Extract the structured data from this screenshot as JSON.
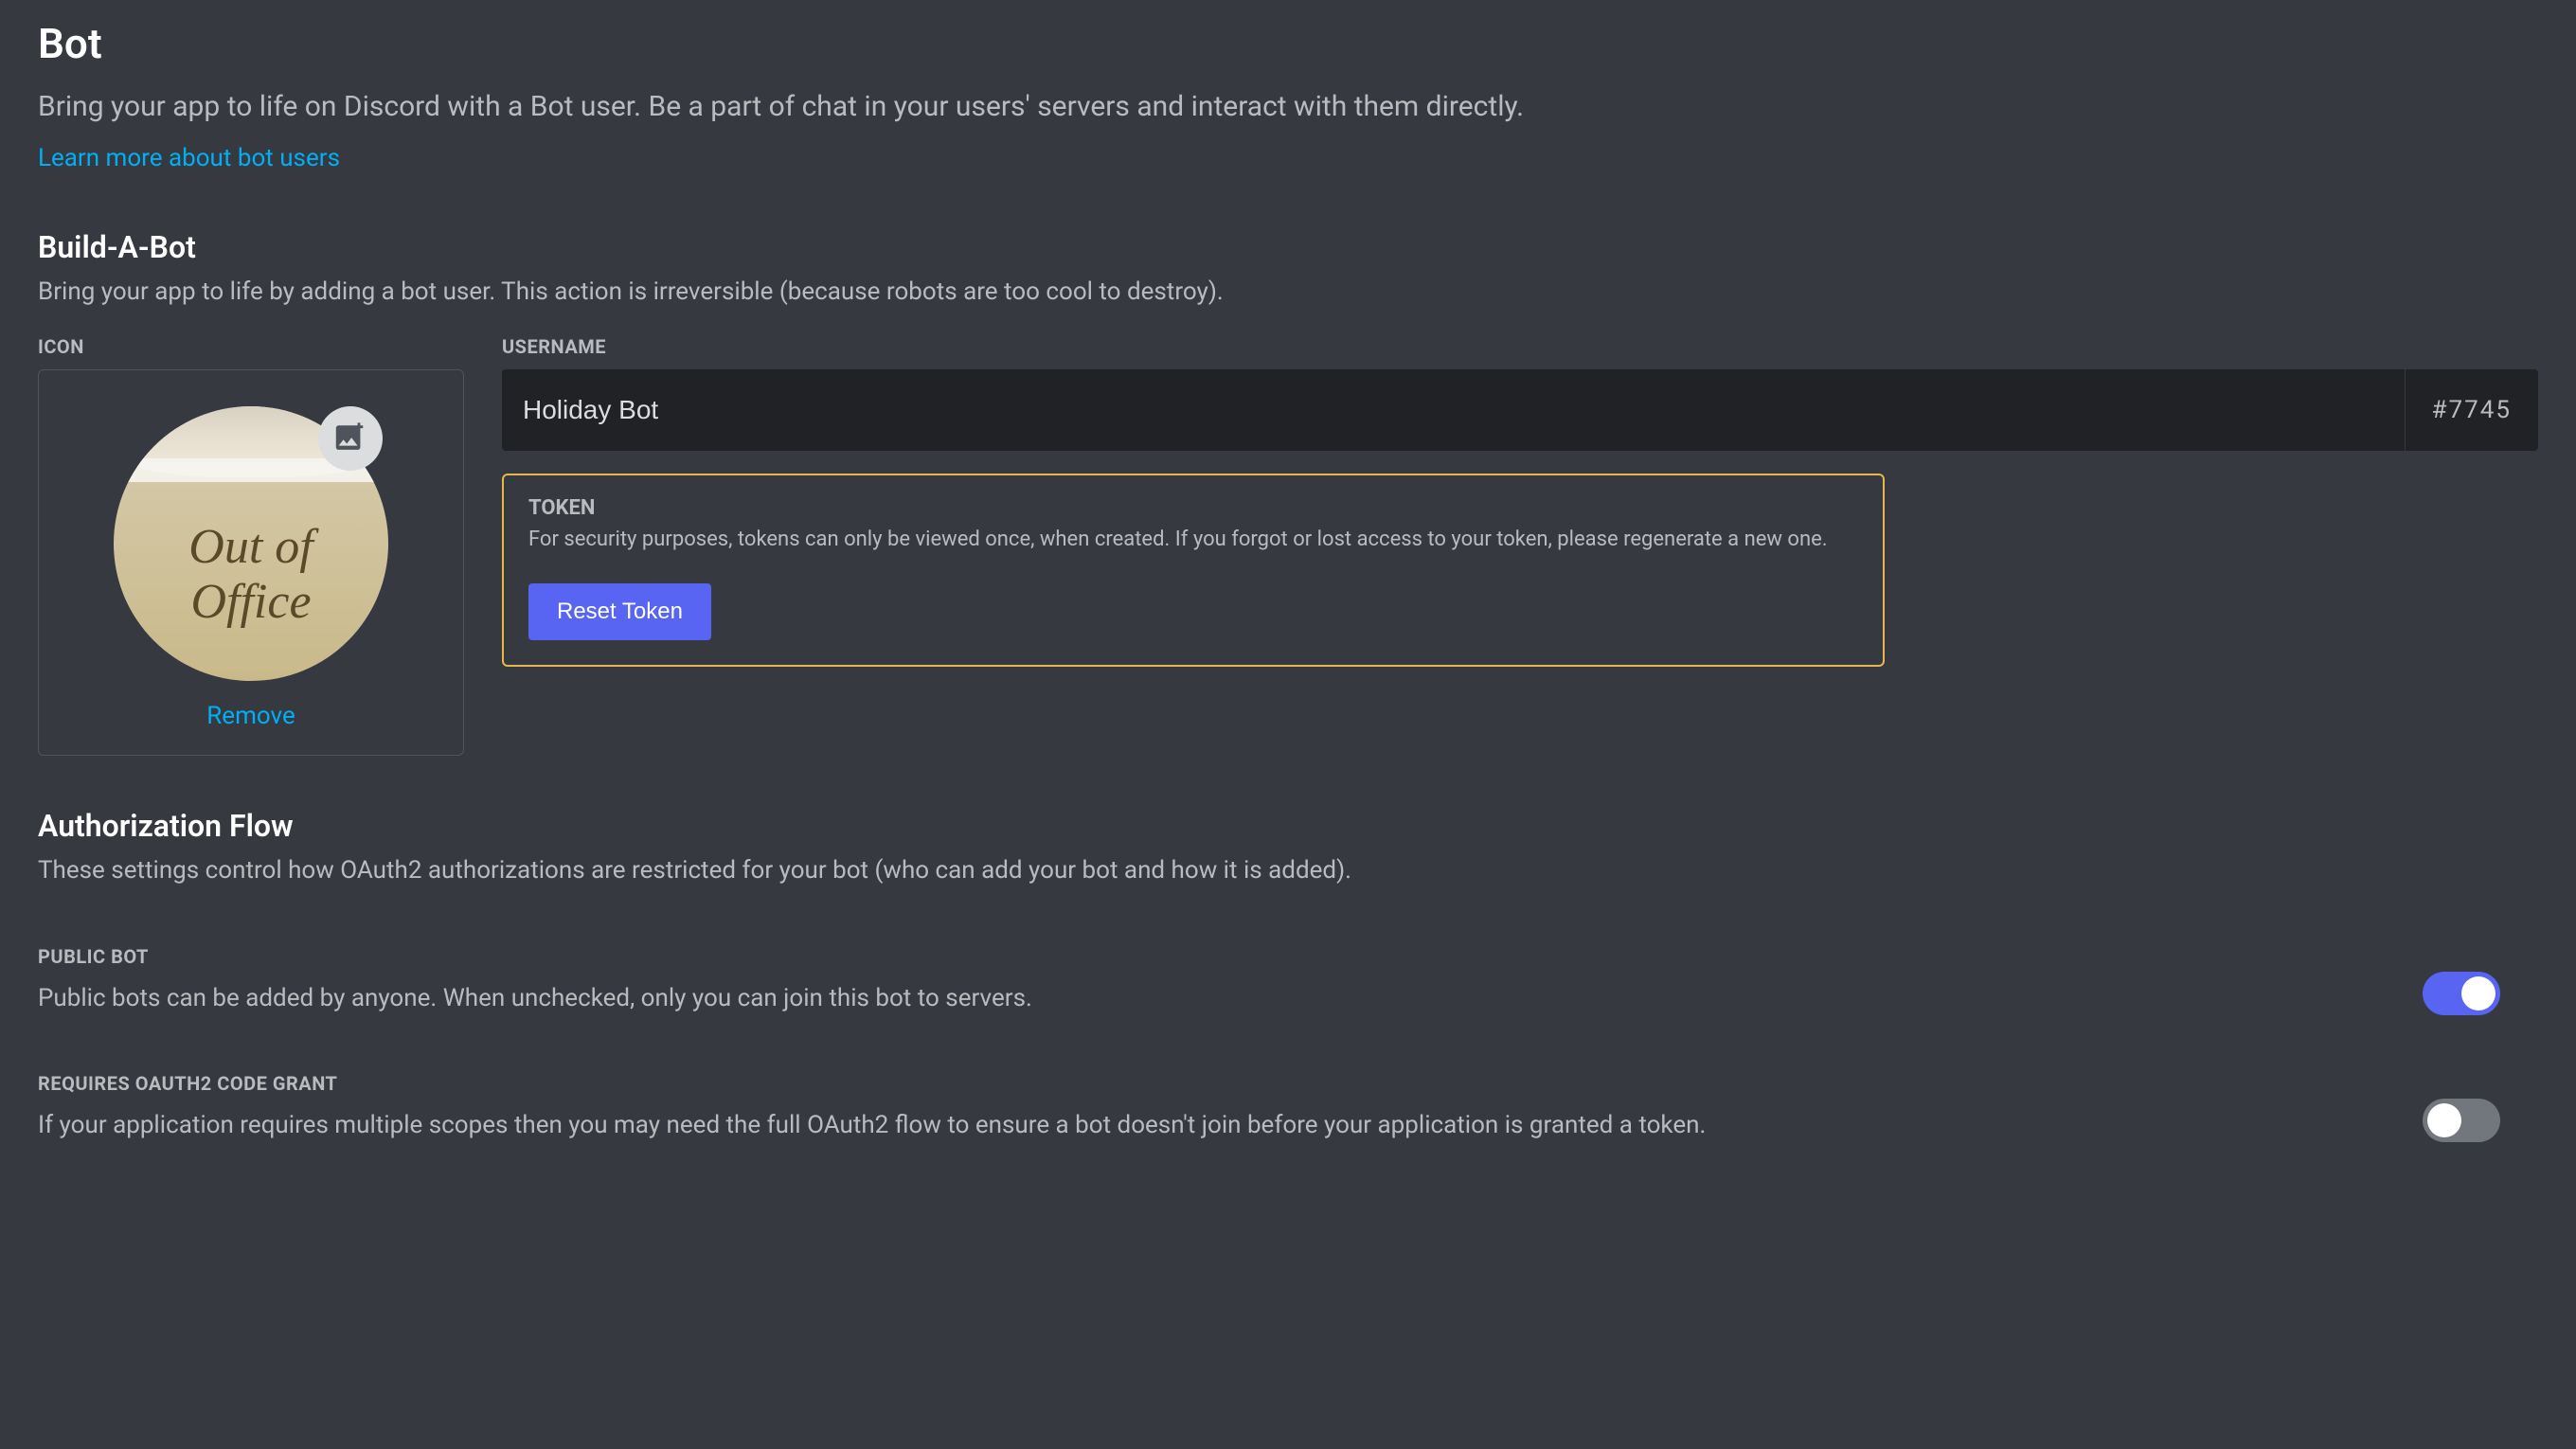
{
  "page": {
    "title": "Bot",
    "description": "Bring your app to life on Discord with a Bot user. Be a part of chat in your users' servers and interact with them directly.",
    "learn_more": "Learn more about bot users"
  },
  "build_a_bot": {
    "title": "Build-A-Bot",
    "description": "Bring your app to life by adding a bot user. This action is irreversible (because robots are too cool to destroy).",
    "icon_label": "ICON",
    "avatar_text_line1": "Out of",
    "avatar_text_line2": "Office",
    "remove_link": "Remove",
    "username_label": "USERNAME",
    "username_value": "Holiday Bot",
    "discriminator": "#7745"
  },
  "token": {
    "label": "TOKEN",
    "description": "For security purposes, tokens can only be viewed once, when created. If you forgot or lost access to your token, please regenerate a new one.",
    "reset_button": "Reset Token"
  },
  "auth_flow": {
    "title": "Authorization Flow",
    "description": "These settings control how OAuth2 authorizations are restricted for your bot (who can add your bot and how it is added)."
  },
  "settings": {
    "public_bot": {
      "label": "PUBLIC BOT",
      "description": "Public bots can be added by anyone. When unchecked, only you can join this bot to servers.",
      "enabled": true
    },
    "oauth2_grant": {
      "label": "REQUIRES OAUTH2 CODE GRANT",
      "description": "If your application requires multiple scopes then you may need the full OAuth2 flow to ensure a bot doesn't join before your application is granted a token.",
      "enabled": false
    }
  }
}
